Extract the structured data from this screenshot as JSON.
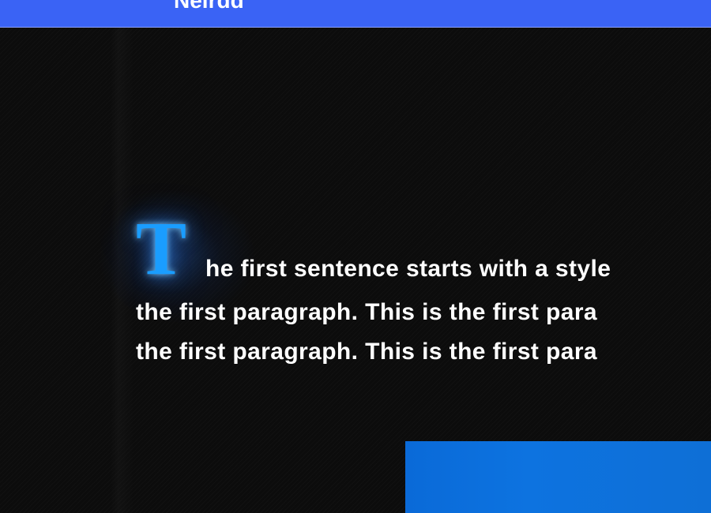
{
  "header": {
    "title": "Neirdd",
    "background_color": "#3a63f5"
  },
  "article": {
    "drop_cap_letter": "T",
    "drop_cap_color": "#1a9dff",
    "first_line_rest": "he first sentence starts with a style",
    "line_2": "the first paragraph. This is the first para",
    "line_3": "the first paragraph. This is the first para"
  },
  "panel": {
    "color": "#0d6fd9"
  }
}
